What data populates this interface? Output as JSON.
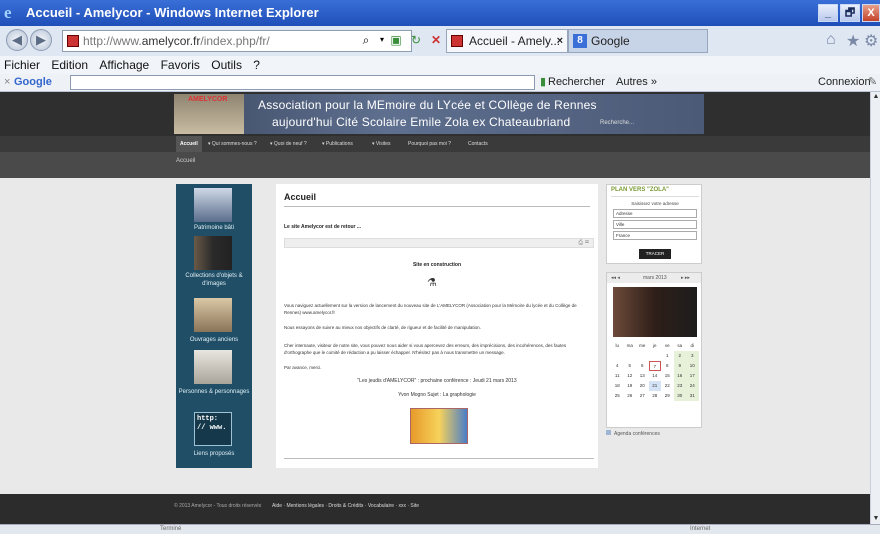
{
  "window": {
    "title": "Accueil - Amelycor - Windows Internet Explorer",
    "minimize": "_",
    "restore": "🗗",
    "close": "X"
  },
  "addressbar": {
    "url_prefix": "http://www.",
    "url_domain": "amelycor.fr",
    "url_path": "/index.php/fr/"
  },
  "tabs": [
    {
      "label": "Accueil - Amely...",
      "close": "×"
    },
    {
      "label": "Google"
    }
  ],
  "menubar": {
    "items": [
      "Fichier",
      "Edition",
      "Affichage",
      "Favoris",
      "Outils",
      "?"
    ]
  },
  "google_toolbar": {
    "close": "×",
    "logo": "Google",
    "search_button": "Rechercher",
    "more": "Autres »",
    "login": "Connexion"
  },
  "site": {
    "banner_tag": "AMELYCOR",
    "banner_line1": "Association pour la MEmoire du LYcée et COllège de Rennes",
    "banner_line2": "aujourd'hui Cité Scolaire Emile Zola ex Chateaubriand",
    "banner_search": "Recherche...",
    "nav": [
      "Accueil",
      "▾ Qui sommes-nous ?",
      "▾ Quoi de neuf ?",
      "▾ Publications",
      "▾ Visites",
      "Pourquoi pas moi ?",
      "Contacts"
    ],
    "breadcrumb": "Accueil",
    "sidebar": [
      {
        "label": "Patrimoine bâti",
        "icon": "building-icon"
      },
      {
        "label": "Collections d'objets & d'images",
        "icon": "collection-icon"
      },
      {
        "label": "Ouvrages anciens",
        "icon": "books-icon"
      },
      {
        "label": "Personnes & personnages",
        "icon": "statue-icon"
      },
      {
        "label": "Liens proposés",
        "icon": "http-link-icon",
        "tile_text": "http: // www."
      }
    ],
    "main": {
      "title": "Accueil",
      "lead": "Le site Amelycor est de retour ...",
      "construction": "Site en construction",
      "p1": "Vous naviguez actuellement sur la version de lancement du nouveau site de L'AMELYCOR (Association pour la Mémoire du lycée et du Collège de Rennes) www.amelycor.fr",
      "p2": "Nous essayons de suivre au mieux nos objectifs de clarté, de rigueur et de facilité de manipulation.",
      "p3": "Cher internaute, visiteur de notre site, vous pouvez nous aider si vous apercevez des erreurs, des imprécisions, des incohérences, des fautes d'orthographe que le comité de rédaction a pu laisser échapper. N'hésitez pas à nous transmettre un message.",
      "p4": "Par avance, merci.",
      "conference_line": "\"Les jeudis d'AMELYCOR\" : prochaine conférence : Jeudi 21 mars 2013",
      "conference_speaker": "Yvon Mogno     Sujet : La graphologie"
    },
    "plan": {
      "title": "PLAN VERS \"ZOLA\"",
      "subtitle": "Saisissez votre adresse",
      "fields": [
        "Adresse",
        "Ville",
        "France"
      ],
      "button": "TRACER"
    },
    "calendar": {
      "month": "mars 2013",
      "days_header": [
        "lu",
        "ma",
        "me",
        "je",
        "ve",
        "sa",
        "di"
      ],
      "weeks": [
        [
          "",
          "",
          "",
          "",
          "1",
          "2",
          "3"
        ],
        [
          "4",
          "5",
          "6",
          "7",
          "8",
          "9",
          "10"
        ],
        [
          "11",
          "12",
          "13",
          "14",
          "15",
          "16",
          "17"
        ],
        [
          "18",
          "19",
          "20",
          "21",
          "22",
          "23",
          "24"
        ],
        [
          "25",
          "26",
          "27",
          "28",
          "29",
          "30",
          "31"
        ]
      ],
      "legend": "Agenda conférences"
    },
    "footer": {
      "copyright": "© 2013 Amelycor - Tous droits réservés",
      "links": "Aide · Mentions légales · Droits & Crédits · Vocabulaire · xxx · Site"
    }
  },
  "status": {
    "left": "Terminé",
    "right": "Internet"
  },
  "colors": {
    "titlebar": "#1f4fb8",
    "sidebar": "#1f4e66",
    "plan_title": "#7a9a33"
  }
}
